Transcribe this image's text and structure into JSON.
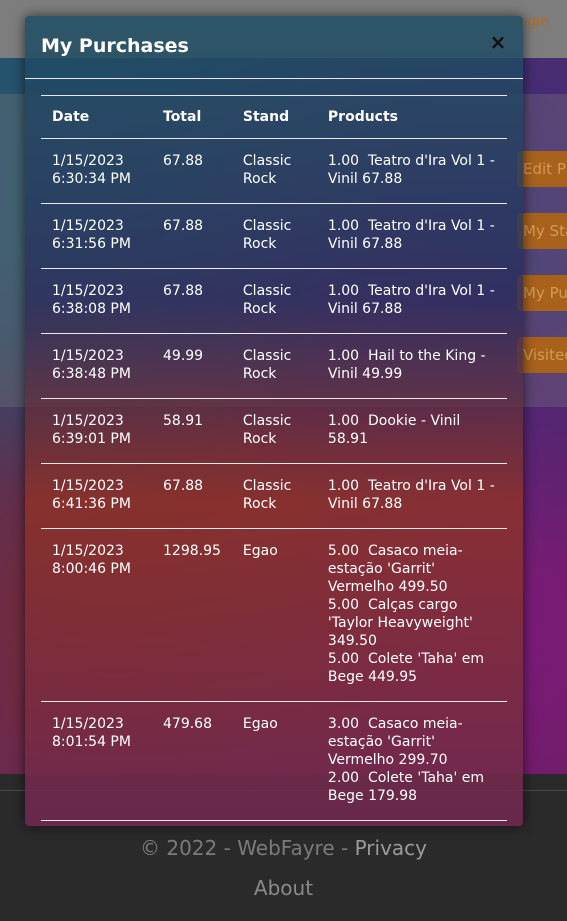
{
  "background": {
    "login_link": "Login",
    "side_buttons": [
      "Edit Profile",
      "My Stand",
      "My Purchases",
      "Visited Fairs"
    ]
  },
  "modal": {
    "title": "My Purchases",
    "close_glyph": "×",
    "columns": [
      "Date",
      "Total",
      "Stand",
      "Products"
    ],
    "rows": [
      {
        "date": "1/15/2023 6:30:34 PM",
        "total": "67.88",
        "stand": "Classic Rock",
        "products": [
          "1.00  Teatro d'Ira Vol 1 - Vinil 67.88"
        ]
      },
      {
        "date": "1/15/2023 6:31:56 PM",
        "total": "67.88",
        "stand": "Classic Rock",
        "products": [
          "1.00  Teatro d'Ira Vol 1 - Vinil 67.88"
        ]
      },
      {
        "date": "1/15/2023 6:38:08 PM",
        "total": "67.88",
        "stand": "Classic Rock",
        "products": [
          "1.00  Teatro d'Ira Vol 1 - Vinil 67.88"
        ]
      },
      {
        "date": "1/15/2023 6:38:48 PM",
        "total": "49.99",
        "stand": "Classic Rock",
        "products": [
          "1.00  Hail to the King - Vinil 49.99"
        ]
      },
      {
        "date": "1/15/2023 6:39:01 PM",
        "total": "58.91",
        "stand": "Classic Rock",
        "products": [
          "1.00  Dookie - Vinil 58.91"
        ]
      },
      {
        "date": "1/15/2023 6:41:36 PM",
        "total": "67.88",
        "stand": "Classic Rock",
        "products": [
          "1.00  Teatro d'Ira Vol 1 - Vinil 67.88"
        ]
      },
      {
        "date": "1/15/2023 8:00:46 PM",
        "total": "1298.95",
        "stand": "Egao",
        "products": [
          "5.00  Casaco meia-estação 'Garrit' Vermelho 499.50",
          "5.00  Calças cargo 'Taylor Heavyweight' 349.50",
          "5.00  Colete 'Taha' em Bege 449.95"
        ]
      },
      {
        "date": "1/15/2023 8:01:54 PM",
        "total": "479.68",
        "stand": "Egao",
        "products": [
          "3.00  Casaco meia-estação 'Garrit' Vermelho 299.70",
          "2.00  Colete 'Taha' em Bege 179.98"
        ]
      }
    ]
  },
  "footer": {
    "copyright": "© 2022 - WebFayre - ",
    "privacy": "Privacy",
    "about": "About"
  }
}
